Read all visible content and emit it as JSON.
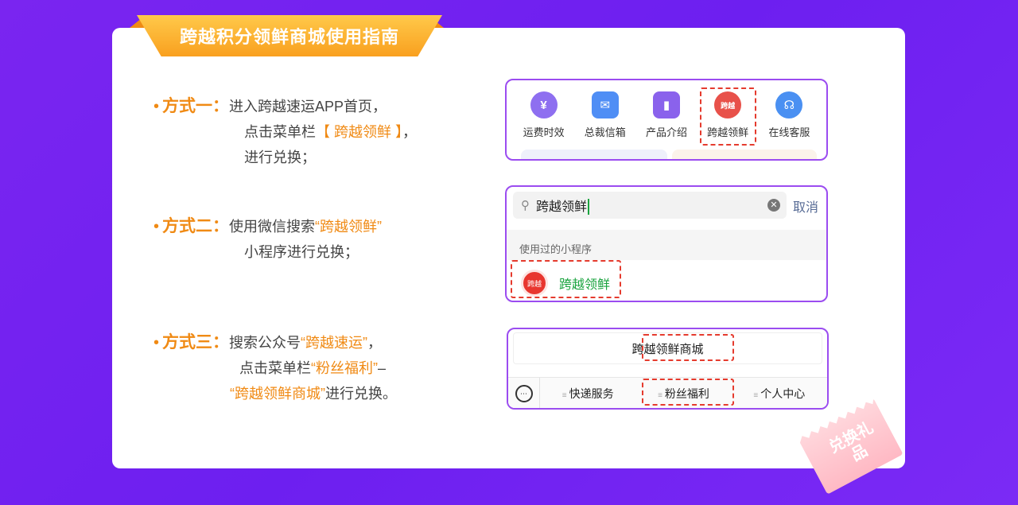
{
  "title": "跨越积分领鲜商城使用指南",
  "methods": [
    {
      "label": "方式一：",
      "lines": [
        {
          "a": "进入跨越速运APP首页，",
          "hl": "",
          "b": ""
        },
        {
          "a": "点击菜单栏",
          "hl": "【 跨越领鲜 】",
          "b": "，"
        },
        {
          "a": "进行兑换；",
          "hl": "",
          "b": ""
        }
      ]
    },
    {
      "label": "方式二：",
      "lines": [
        {
          "a": "使用微信搜索",
          "hl": "“跨越领鲜”",
          "b": ""
        },
        {
          "a": "小程序进行兑换；",
          "hl": "",
          "b": ""
        }
      ]
    },
    {
      "label": "方式三：",
      "lines": [
        {
          "a": "搜索公众号",
          "hl": "“跨越速运”",
          "b": "，"
        },
        {
          "a": "点击菜单栏",
          "hl": "“粉丝福利”",
          "b": "–"
        },
        {
          "a": "",
          "hl": "“跨越领鲜商城”",
          "b": "进行兑换。"
        }
      ]
    }
  ],
  "app_panel": {
    "icons": [
      {
        "name": "运费时效",
        "glyph": "¥",
        "color": "#8e6ff0"
      },
      {
        "name": "总裁信箱",
        "glyph": "✉",
        "color": "#4f8ef5"
      },
      {
        "name": "产品介绍",
        "glyph": "▮",
        "color": "#8a62ec"
      },
      {
        "name": "跨越领鲜",
        "glyph": "跨越",
        "color": "#e8514a"
      },
      {
        "name": "在线客服",
        "glyph": "☊",
        "color": "#4a90f2"
      }
    ]
  },
  "wechat_panel": {
    "query": "跨越领鲜",
    "cancel": "取消",
    "section": "使用过的小程序",
    "result": "跨越领鲜",
    "logo_text": "跨越"
  },
  "official_panel": {
    "banner": "跨越领鲜商城",
    "menu": [
      "快递服务",
      "粉丝福利",
      "个人中心"
    ]
  },
  "stamp": {
    "text": "兑换礼品"
  },
  "colors": {
    "accent": "#f08a14",
    "purple": "#7a25f0",
    "highlight": "#e53b2e",
    "wechat_green": "#19a33e"
  }
}
